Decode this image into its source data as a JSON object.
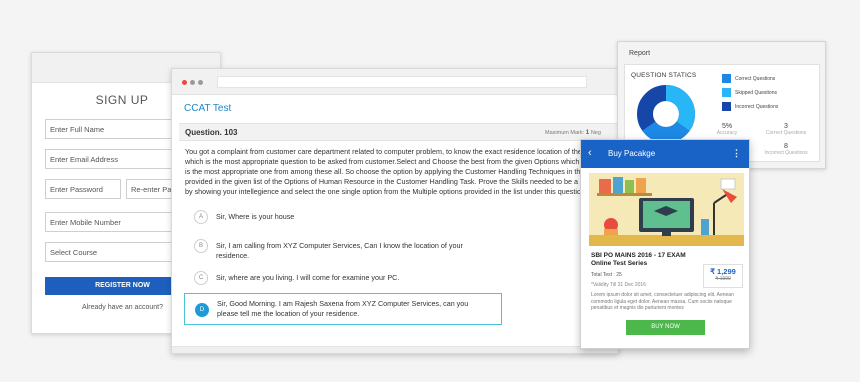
{
  "signup": {
    "title": "SIGN UP",
    "full_name_placeholder": "Enter Full Name",
    "email_placeholder": "Enter Email Address",
    "password_placeholder": "Enter Password",
    "reenter_password_placeholder": "Re-enter Password",
    "mobile_placeholder": "Enter Mobile Number",
    "course_placeholder": "Select Course",
    "register_label": "REGISTER NOW",
    "login_link": "Already have an account?"
  },
  "test": {
    "title": "CCAT Test",
    "question_label": "Question. 103",
    "max_mark_label": "Maximum Mark:",
    "max_mark_value": "1",
    "neg_label": "Neg",
    "question_text": "You got a complaint from customer care department related to computer problem, to know the exact residence location of the customer which is the most appropriate question to be asked from customer.Select and Choose the best from the given Options which you think is the most appropriate one from among these all. So choose the option by applying the Customer Handling Techniques in the Scenario provided in the given list of the Options of Human Resource in the Customer Handling Task. Prove the Skills needed to be a good HR by showing your intellegience and select the one single option from the Multiple options provided in the list under this question.",
    "options": [
      {
        "letter": "A",
        "text": "Sir, Where is your house"
      },
      {
        "letter": "B",
        "text": "Sir, I am calling from XYZ Computer Services, Can I know the location of your residence."
      },
      {
        "letter": "C",
        "text": "Sir, where are you living. I will come for examine your PC."
      },
      {
        "letter": "D",
        "text": "Sir, Good Morning. I am Rajesh Saxena from XYZ Computer Services, can you please tell me the location of your residence."
      }
    ],
    "selected_option": "D"
  },
  "report": {
    "title": "Report",
    "stats_title": "QUESTION STATICS",
    "legend": [
      {
        "label": "Correct Questions",
        "color": "#1e88e5"
      },
      {
        "label": "Skipped Questions",
        "color": "#29b6f6"
      },
      {
        "label": "Incorrect Questions",
        "color": "#1546a8"
      }
    ],
    "accuracy_value": "5%",
    "accuracy_label": "Accuracy",
    "correct_value": "3",
    "correct_label": "Correct Questions",
    "incorrect_value": "8",
    "incorrect_label": "Incorrect Questions"
  },
  "package": {
    "appbar_title": "Buy Pacakge",
    "product_title": "SBI PO MAINS 2016 - 17 EXAM Online Test Series",
    "total_test": "Total Test : 25",
    "validity": "*Validity Till 31 Dec 2016",
    "price": "₹ 1,299",
    "old_price": "₹ 1999",
    "description": "Lorem ipsum dolor sit amet, consectetuer adipiscing elit. Aenean commodo ligula eget dolor. Aenean massa. Cum sociis natoque penatibus et magnis dis parturient montes",
    "buy_label": "BUY NOW"
  },
  "colors": {
    "primary_blue": "#1a63c6",
    "accent_cyan": "#1e9bd7",
    "buy_green": "#4cb84c"
  }
}
